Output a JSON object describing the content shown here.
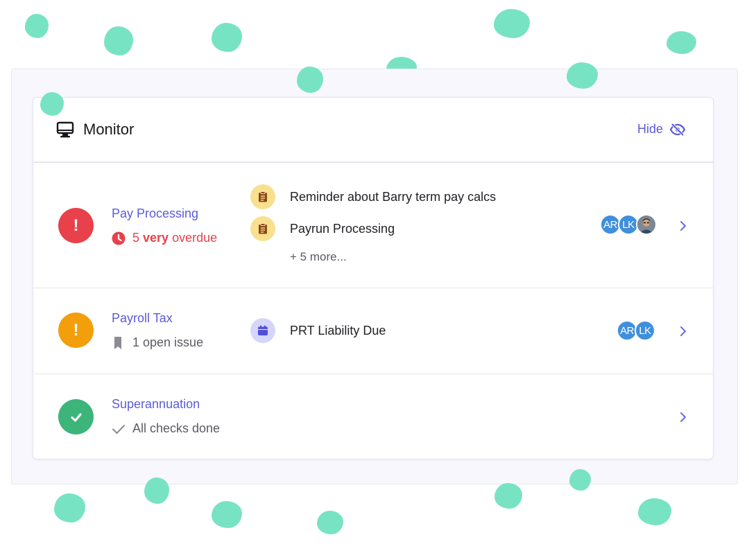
{
  "monitor": {
    "title": "Monitor",
    "hide_label": "Hide"
  },
  "rows": [
    {
      "title": "Pay Processing",
      "status": "error",
      "status_symbol": "!",
      "sub_count": "5",
      "sub_emphasis": "very",
      "sub_suffix": "overdue",
      "tasks": [
        {
          "label": "Reminder about Barry term pay calcs",
          "icon": "clipboard-icon"
        },
        {
          "label": "Payrun Processing",
          "icon": "clipboard-icon"
        }
      ],
      "more": "+ 5 more...",
      "avatars": [
        "AR",
        "LK"
      ],
      "has_photo_avatar": true
    },
    {
      "title": "Payroll Tax",
      "status": "warning",
      "status_symbol": "!",
      "sub": "1 open issue",
      "tasks": [
        {
          "label": "PRT Liability Due",
          "icon": "calendar-icon"
        }
      ],
      "avatars": [
        "AR",
        "LK"
      ]
    },
    {
      "title": "Superannuation",
      "status": "done",
      "sub": "All checks done"
    }
  ],
  "colors": {
    "accent": "#5b5bdb",
    "error": "#e8414b",
    "warning": "#f29f0b",
    "success": "#3db57a",
    "blob": "#78e3c3"
  }
}
